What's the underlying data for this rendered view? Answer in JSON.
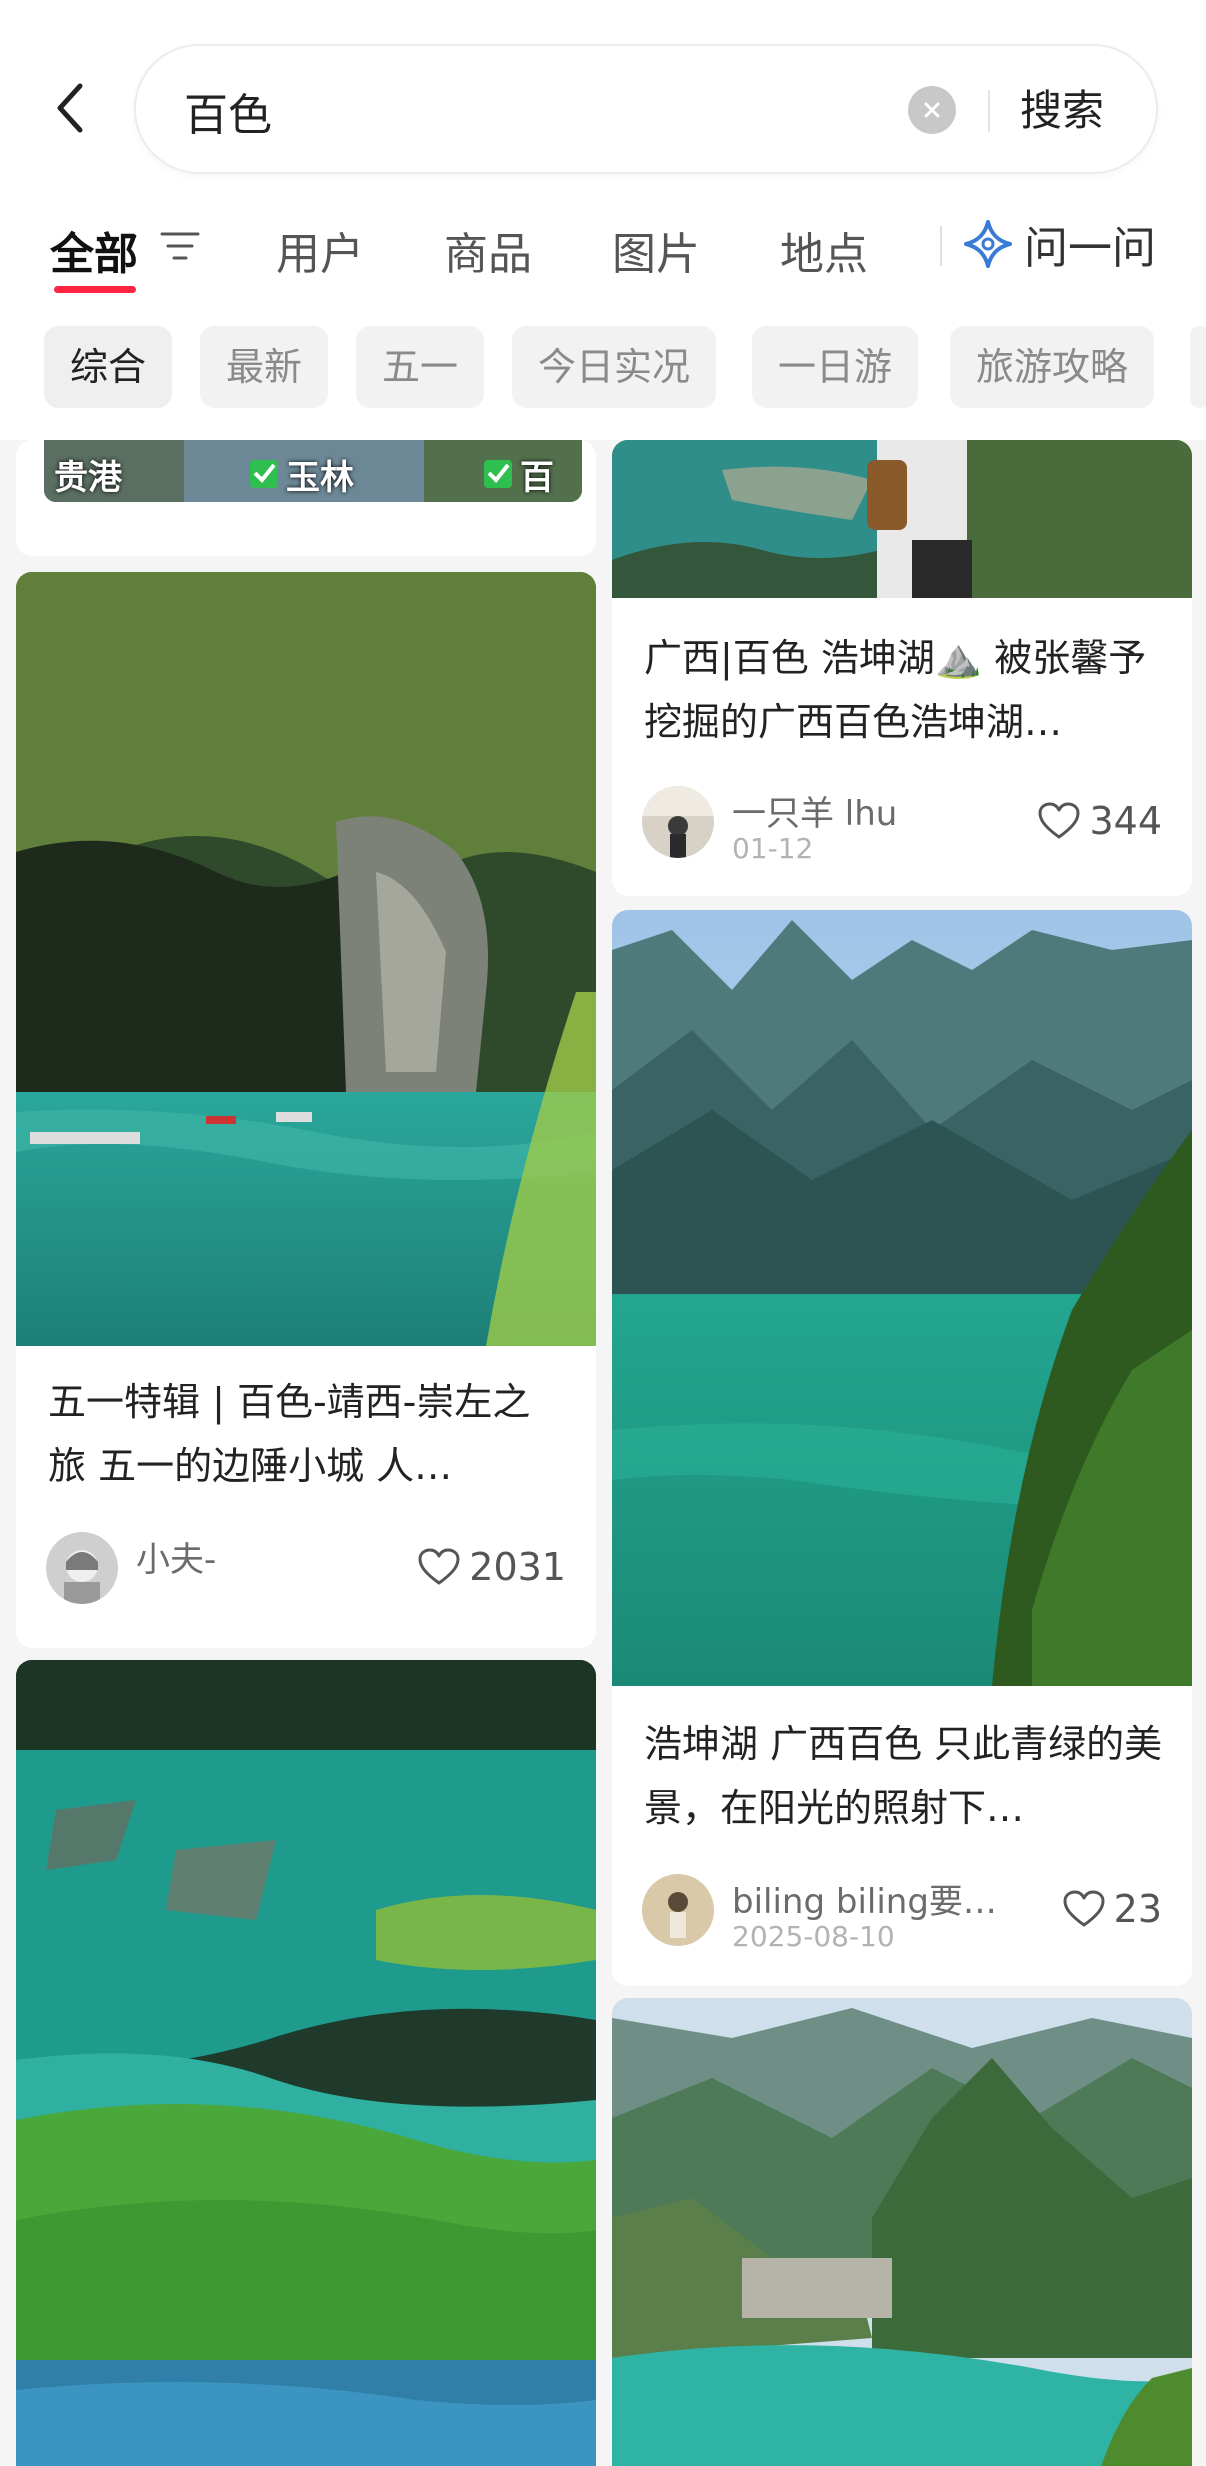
{
  "search": {
    "query": "百色",
    "submit_label": "搜索"
  },
  "tabs": [
    {
      "label": "全部"
    },
    {
      "label": "用户"
    },
    {
      "label": "商品"
    },
    {
      "label": "图片"
    },
    {
      "label": "地点"
    }
  ],
  "ask": {
    "label": "问一问",
    "icon": "sparkle-icon",
    "color": "#3a7bd5"
  },
  "chips": [
    {
      "label": "综合"
    },
    {
      "label": "最新"
    },
    {
      "label": "五一"
    },
    {
      "label": "今日实况"
    },
    {
      "label": "一日游"
    },
    {
      "label": "旅游攻略"
    }
  ],
  "accent_color": "#ff2442",
  "partial_top_card": {
    "labels": [
      "贵港",
      "玉林",
      "百"
    ]
  },
  "cards": {
    "guangxi_haokun": {
      "title": "广西|百色 浩坤湖⛰️ 被张馨予挖掘的广西百色浩坤湖…",
      "author": "一只羊 lhu",
      "date": "01-12",
      "likes": "344"
    },
    "wuyi_special": {
      "title": "五一特辑 | 百色-靖西-崇左之旅 五一的边陲小城 人…",
      "author": "小夫-",
      "likes": "2031"
    },
    "haokun_green": {
      "title": "浩坤湖 广西百色 只此青绿的美景，在阳光的照射下…",
      "author": "biling biling要…",
      "date": "2025-08-10",
      "likes": "23"
    }
  }
}
